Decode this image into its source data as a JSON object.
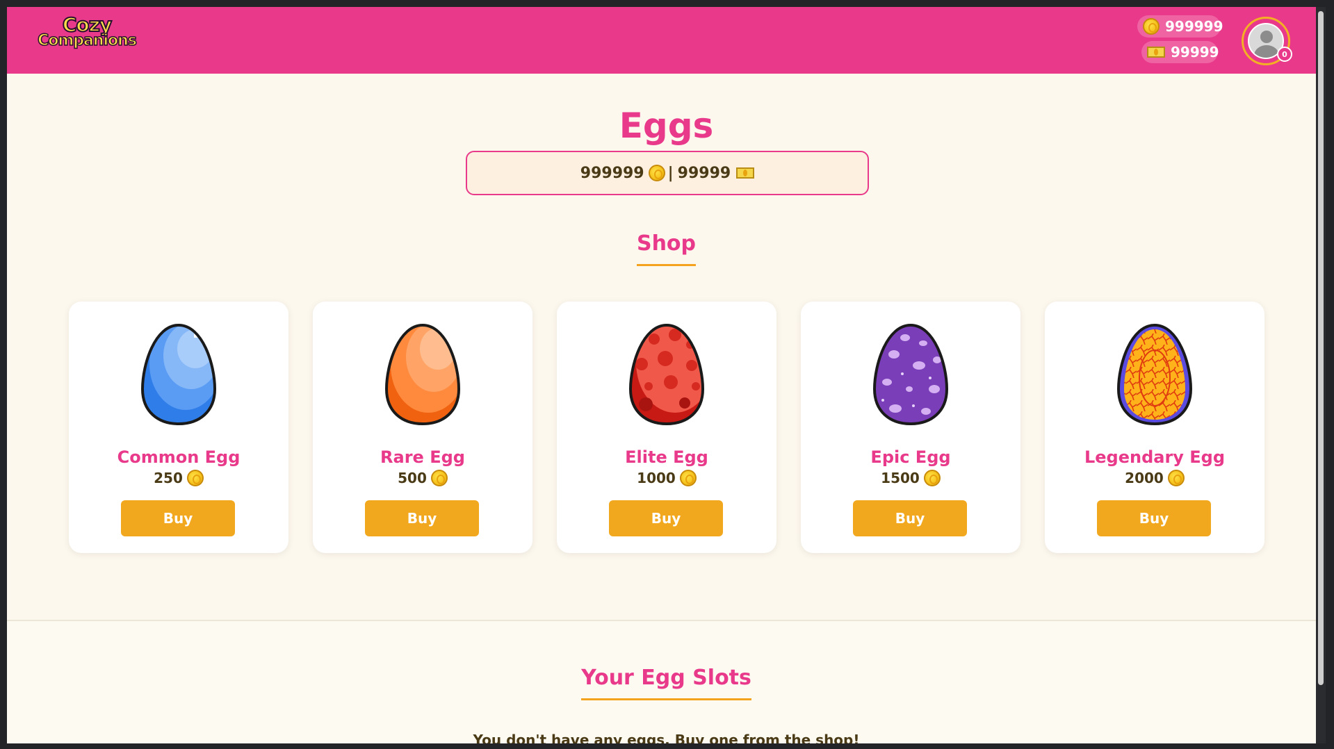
{
  "header": {
    "logo_line1": "Cozy",
    "logo_line2": "Companions",
    "coins": "999999",
    "cash": "99999",
    "notification_count": "0"
  },
  "page": {
    "title": "Eggs",
    "balance_coins": "999999",
    "balance_separator": "|",
    "balance_cash": "99999"
  },
  "shop": {
    "title": "Shop",
    "buy_label": "Buy",
    "eggs": [
      {
        "name": "Common Egg",
        "price": "250",
        "color": "#3f8bf2"
      },
      {
        "name": "Rare Egg",
        "price": "500",
        "color": "#ff8a3d"
      },
      {
        "name": "Elite Egg",
        "price": "1000",
        "color": "#e8473a"
      },
      {
        "name": "Epic Egg",
        "price": "1500",
        "color": "#8a4fc6"
      },
      {
        "name": "Legendary Egg",
        "price": "2000",
        "color": "#ffb21a"
      }
    ]
  },
  "slots": {
    "title": "Your Egg Slots",
    "empty_message": "You don't have any eggs. Buy one from the shop!"
  },
  "colors": {
    "brand_pink": "#e8398a",
    "accent_gold": "#f2a81e",
    "background": "#fdf8ee"
  }
}
